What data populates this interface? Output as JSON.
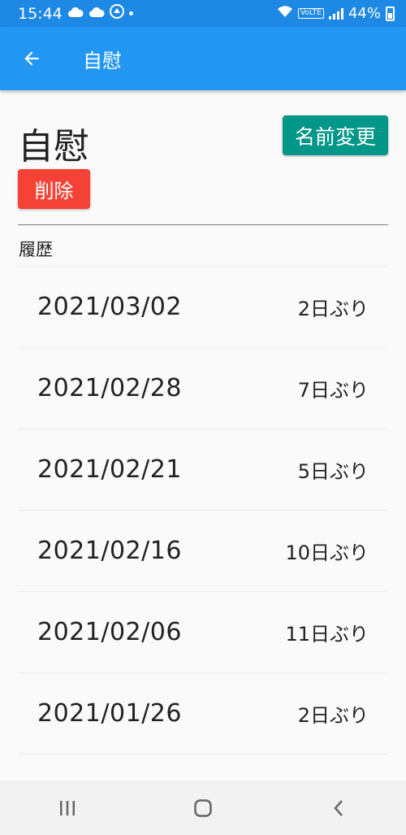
{
  "status_bar": {
    "time": "15:44",
    "battery": "44%",
    "volte": "VoLTE"
  },
  "app_bar": {
    "title": "自慰"
  },
  "main": {
    "title": "自慰",
    "rename_label": "名前変更",
    "delete_label": "削除",
    "history_label": "履歴",
    "history": [
      {
        "date": "2021/03/02",
        "gap": "2日ぶり"
      },
      {
        "date": "2021/02/28",
        "gap": "7日ぶり"
      },
      {
        "date": "2021/02/21",
        "gap": "5日ぶり"
      },
      {
        "date": "2021/02/16",
        "gap": "10日ぶり"
      },
      {
        "date": "2021/02/06",
        "gap": "11日ぶり"
      },
      {
        "date": "2021/01/26",
        "gap": "2日ぶり"
      }
    ]
  },
  "colors": {
    "app_bar": "#2196f3",
    "status_bar": "#1e88e5",
    "rename_button": "#009688",
    "delete_button": "#f44336"
  },
  "icons": {
    "back": "arrow-left-icon",
    "recents": "recents-icon",
    "home": "home-icon",
    "nav_back": "chevron-left-icon"
  }
}
